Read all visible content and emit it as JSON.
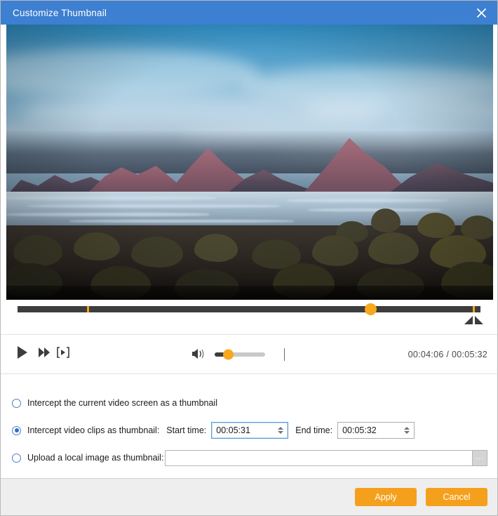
{
  "window": {
    "title": "Customize Thumbnail",
    "close_icon": "close-icon",
    "accent_blue": "#3d7fd1",
    "accent_orange": "#f5a01c"
  },
  "player": {
    "timeline": {
      "handle_position_percent": 76,
      "marker_positions_percent": [
        15,
        98
      ]
    },
    "controls": {
      "play_icon": "play-icon",
      "next_frame_icon": "fast-forward-icon",
      "snapshot_icon": "frame-capture-icon",
      "volume_icon": "speaker-icon",
      "volume_percent": 22,
      "trim_left_icon": "trim-left-triangle-icon",
      "trim_right_icon": "trim-right-triangle-icon"
    },
    "time": {
      "current": "00:04:06",
      "separator": "/",
      "total": "00:05:32",
      "display": "00:04:06 / 00:05:32"
    }
  },
  "options": {
    "current_screen": {
      "label": "Intercept the current video screen as a thumbnail",
      "selected": false
    },
    "video_clips": {
      "label": "Intercept video clips as thumbnail:",
      "selected": true,
      "start_time_label": "Start time:",
      "start_time_value": "00:05:31",
      "end_time_label": "End time:",
      "end_time_value": "00:05:32"
    },
    "upload_image": {
      "label": "Upload a local image as thumbnail:",
      "selected": false,
      "path_value": "",
      "path_placeholder": "",
      "browse_label": "..."
    }
  },
  "footer": {
    "apply_label": "Apply",
    "cancel_label": "Cancel"
  }
}
